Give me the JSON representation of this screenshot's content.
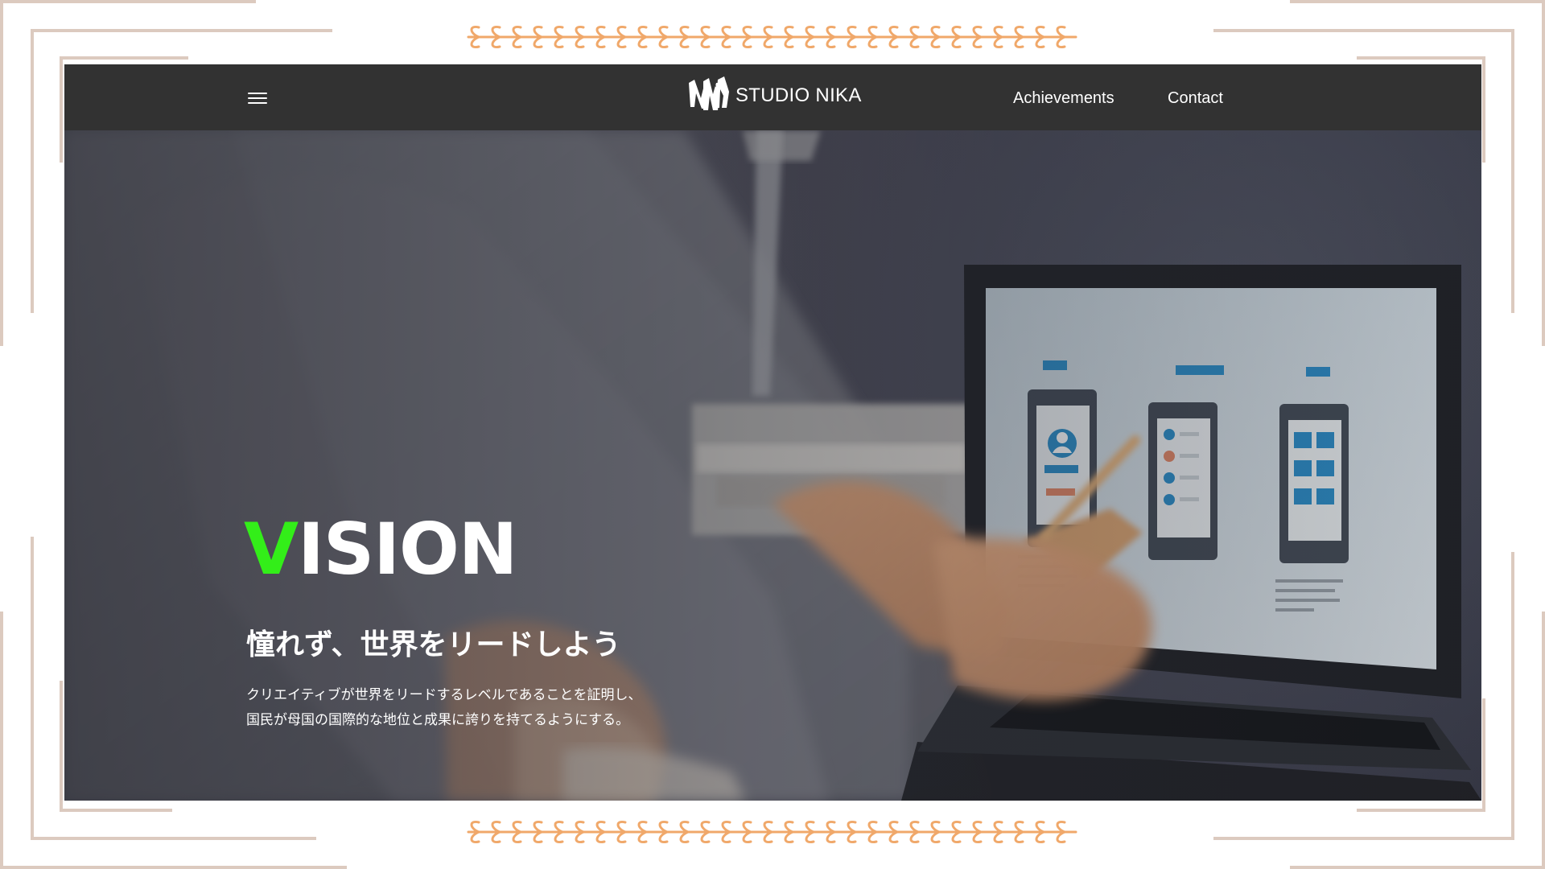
{
  "header": {
    "menu_icon": "hamburger-menu-icon",
    "logo_mark_icon": "studio-nika-logo-mark",
    "logo_text": "STUDIO NIKA",
    "nav_items": [
      {
        "label": "Achievements"
      },
      {
        "label": "Contact"
      }
    ]
  },
  "hero": {
    "title_accent": "V",
    "title_rest": "ISION",
    "subtitle": "憧れず、世界をリードしよう",
    "description_lines": [
      "クリエイティブが世界をリードするレベルであることを証明し、",
      "国民が母国の国際的な地位と成果に誇りを持てるようにする。"
    ]
  },
  "decor": {
    "leaf_garland_icon": "leaf-garland-icon"
  },
  "colors": {
    "accent": "#33ee19",
    "header": "#323232",
    "frame": "#dccabf",
    "garland": "#f0a86a"
  }
}
